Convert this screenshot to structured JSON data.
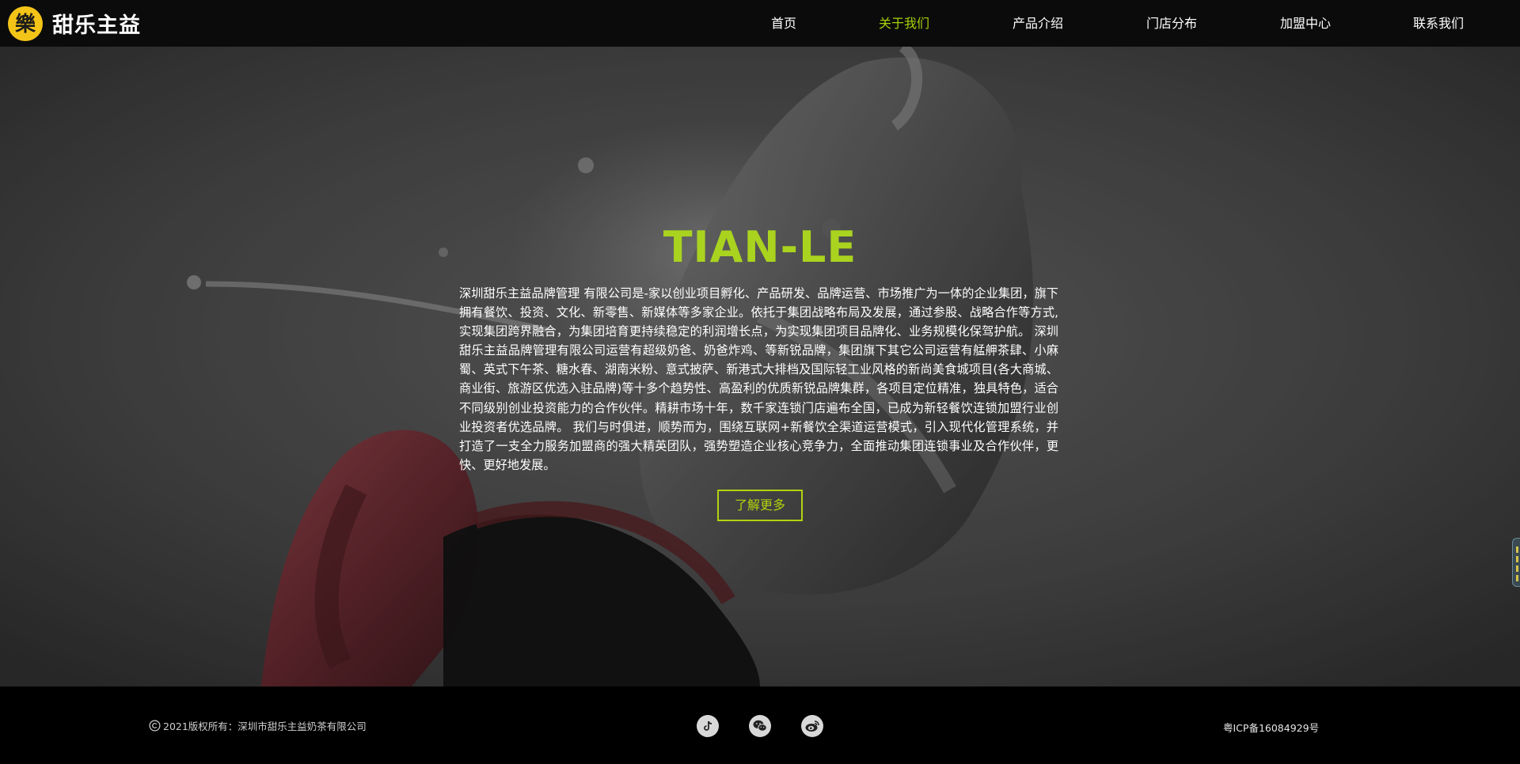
{
  "header": {
    "logo_text": "甜乐主益",
    "logo_glyph": "樂",
    "nav": [
      {
        "label": "首页",
        "active": false
      },
      {
        "label": "关于我们",
        "active": true
      },
      {
        "label": "产品介绍",
        "active": false
      },
      {
        "label": "门店分布",
        "active": false
      },
      {
        "label": "加盟中心",
        "active": false
      },
      {
        "label": "联系我们",
        "active": false
      }
    ]
  },
  "hero": {
    "title": "TIAN-LE",
    "body": "深圳甜乐主益品牌管理 有限公司是-家以创业项目孵化、产品研发、品牌运营、市场推广为一体的企业集团，旗下拥有餐饮、投资、文化、新零售、新媒体等多家企业。依托于集团战略布局及发展，通过参股、战略合作等方式,实现集团跨界融合，为集团培育更持续稳定的利润增长点，为实现集团项目品牌化、业务规模化保驾护航。 深圳甜乐主益品牌管理有限公司运营有超级奶爸、奶爸炸鸡、等新锐品牌，集团旗下其它公司运营有艋舺茶肆、小麻蜀、英式下午茶、糖水春、湖南米粉、意式披萨、新港式大排档及国际轻工业风格的新尚美食城项目(各大商城、商业街、旅游区优选入驻品牌)等十多个趋势性、高盈利的优质新锐品牌集群，各项目定位精准，独具特色，适合不同级别创业投资能力的合作伙伴。精耕市场十年，数千家连锁门店遍布全国，已成为新轻餐饮连锁加盟行业创业投资者优选品牌。 我们与时俱进，顺势而为，围绕互联网+新餐饮全渠道运营模式，引入现代化管理系统，并打造了一支全力服务加盟商的强大精英团队，强势塑造企业核心竞争力，全面推动集团连锁事业及合作伙伴，更快、更好地发展。",
    "button_label": "了解更多"
  },
  "footer": {
    "copyright": "2021版权所有：深圳市甜乐主益奶茶有限公司",
    "social_icons": [
      "tiktok-icon",
      "wechat-icon",
      "weibo-icon"
    ],
    "icp": "粤ICP备16084929号"
  },
  "colors": {
    "accent": "#a9d31f",
    "button": "#b2d30e",
    "logo_yellow": "#f3c418",
    "header_bg": "#0b0b0b",
    "footer_bg": "#000000"
  }
}
